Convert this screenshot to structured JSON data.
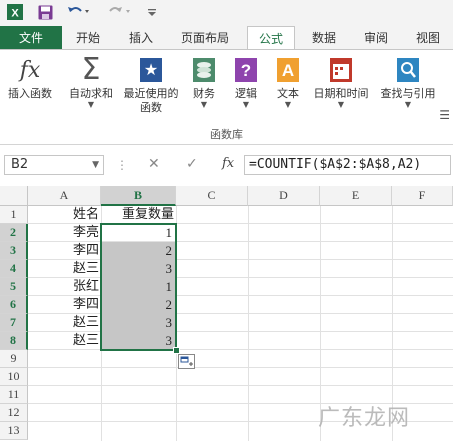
{
  "quick_access": {
    "icons": [
      "excel-icon",
      "save-icon",
      "undo-icon",
      "redo-icon",
      "customize-icon"
    ]
  },
  "tabs": {
    "file": "文件",
    "items": [
      "开始",
      "插入",
      "页面布局",
      "公式",
      "数据",
      "审阅",
      "视图"
    ],
    "active": "公式"
  },
  "ribbon": {
    "buttons": [
      "插入函数",
      "自动求和",
      "最近使用的\n函数",
      "财务",
      "逻辑",
      "文本",
      "日期和时间",
      "查找与引用"
    ],
    "group_label": "函数库"
  },
  "formula_bar": {
    "name_box": "B2",
    "cancel": "✕",
    "enter": "✓",
    "fx": "fx",
    "formula": "=COUNTIF($A$2:$A$8,A2)"
  },
  "sheet": {
    "columns": [
      "A",
      "B",
      "C",
      "D",
      "E",
      "F"
    ],
    "rows": [
      "1",
      "2",
      "3",
      "4",
      "5",
      "6",
      "7",
      "8",
      "9",
      "10",
      "11",
      "12",
      "13"
    ],
    "header_row": {
      "a": "姓名",
      "b": "重复数量"
    },
    "data": [
      {
        "name": "李亮",
        "count": "1"
      },
      {
        "name": "李四",
        "count": "2"
      },
      {
        "name": "赵三",
        "count": "3"
      },
      {
        "name": "张红",
        "count": "1"
      },
      {
        "name": "李四",
        "count": "2"
      },
      {
        "name": "赵三",
        "count": "3"
      },
      {
        "name": "赵三",
        "count": "3"
      }
    ],
    "selected_cell": "B2",
    "selected_column": "B"
  },
  "watermark": "广东龙网",
  "colors": {
    "accent": "#217346",
    "selection_fill": "#c6c6c6"
  }
}
